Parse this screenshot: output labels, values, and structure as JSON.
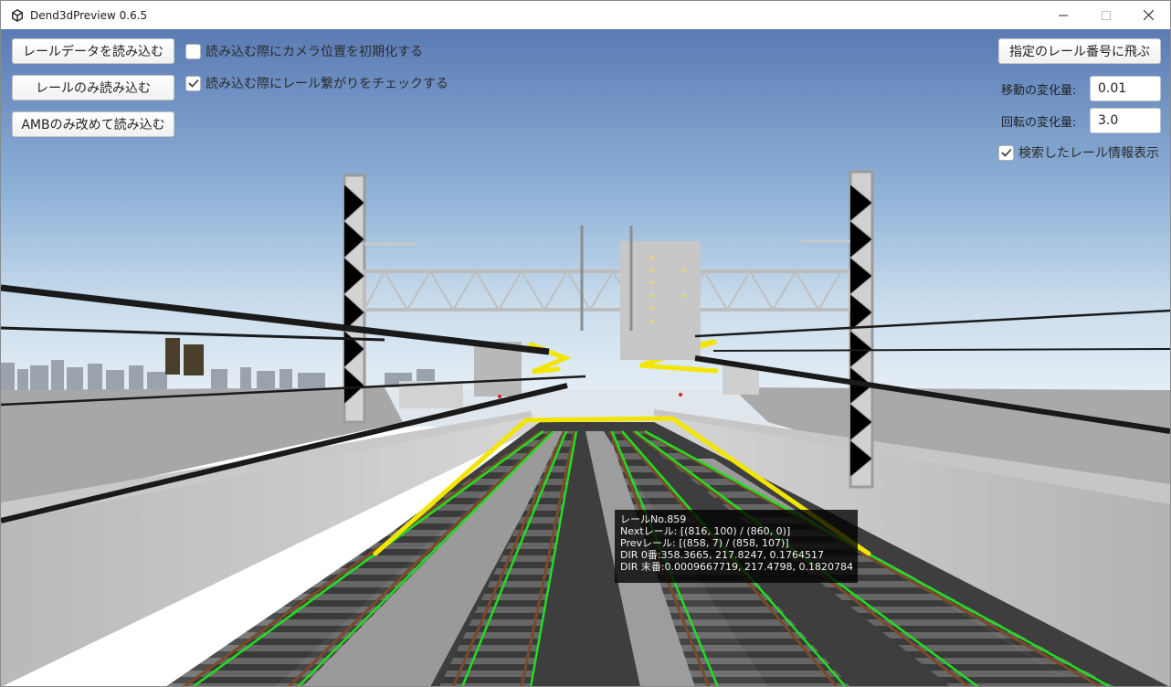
{
  "window": {
    "title": "Dend3dPreview 0.6.5",
    "icon": "unity-logo-icon"
  },
  "left_panel": {
    "load_rail_data_button": "レールデータを読み込む",
    "load_rail_only_button": "レールのみ読み込む",
    "reload_amb_button": "AMBのみ改めて読み込む",
    "reset_camera_toggle": {
      "label": "読み込む際にカメラ位置を初期化する",
      "checked": false
    },
    "check_connection_toggle": {
      "label": "読み込む際にレール繋がりをチェックする",
      "checked": true
    }
  },
  "right_panel": {
    "jump_button": "指定のレール番号に飛ぶ",
    "move_delta_label": "移動の変化量:",
    "move_delta_value": "0.01",
    "rotate_delta_label": "回転の変化量:",
    "rotate_delta_value": "3.0",
    "show_info_toggle": {
      "label": "検索したレール情報表示",
      "checked": true
    }
  },
  "rail_info": {
    "rail_no": "レールNo.859",
    "next": "Nextレール:  [(816, 100) / (860, 0)]",
    "prev": "Prevレール:  [(858, 7) / (858, 107)]",
    "dir_first": "DIR  0番:358.3665, 217.8247, 0.1764517",
    "dir_last": "DIR 末番:0.0009667719, 217.4798, 0.1820784"
  },
  "colors": {
    "sky_top": "#5c7eb5",
    "sky_horizon": "#dfe8f0",
    "highlight_rail": "#f2e600",
    "guide_line": "#22dd22",
    "rail_brown": "#7a4a2a"
  }
}
